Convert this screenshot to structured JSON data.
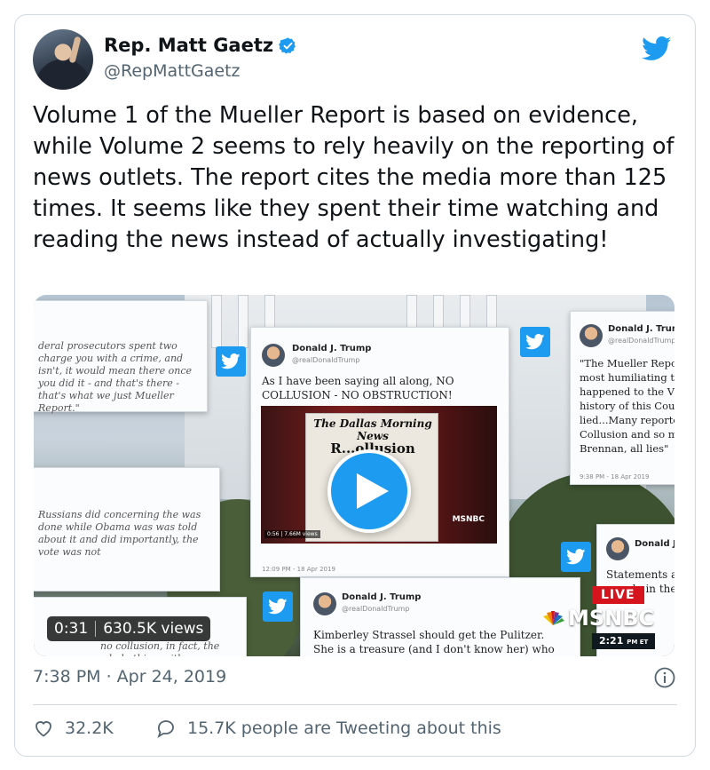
{
  "tweet": {
    "author": {
      "display_name": "Rep. Matt Gaetz",
      "handle": "@RepMattGaetz",
      "verified": true
    },
    "text": "Volume 1 of the Mueller Report is based on evidence, while Volume 2 seems to rely heavily on the reporting of news outlets. The report cites the media more than 125 times. It seems like they spent their time watching and reading the news instead of actually investigating!",
    "timestamp": "7:38 PM · Apr 24, 2019",
    "likes": "32.2K",
    "replies_label": "15.7K people are Tweeting about this"
  },
  "video": {
    "duration": "0:31",
    "views": "630.5K views",
    "overlay": {
      "live_label": "LIVE",
      "network": "MSNBC",
      "clock": "2:21",
      "clock_zone": "PM ET",
      "panel_left_top": "deral prosecutors spent two charge you with a crime, and isn't, it would mean there once you did it - and that's there - that's what we just Mueller Report.\"",
      "panel_left_mid": "Russians did concerning the was done while Obama was was told about it and did importantly, the vote was not",
      "panel_left_bottom": "no collusion, in fact, the whole thing with",
      "center_name": "Donald J. Trump",
      "center_handle": "@realDonaldTrump",
      "center_text": "As I have been saying all along, NO COLLUSION - NO OBSTRUCTION!",
      "center_time": "12:09 PM - 18 Apr 2019",
      "newspaper_title": "The Dallas Morning News",
      "newspaper_headline": "R...ollusion",
      "newspaper_views": "0:56 | 7.66M views",
      "newspaper_network": "MSNBC",
      "right_top_name": "Donald J. Trump",
      "right_top_handle": "@realDonaldTrump",
      "right_top_text": "\"The Mueller Repo most humiliating t happened to the V history of this Cou lied...Many reporte Collusion and so m Brennan, all lies\"",
      "right_top_time": "9:38 PM - 18 Apr 2019",
      "right_bottom_name": "Donald J. Tr",
      "right_bottom_text": "Statements ar people in the",
      "bottom_name": "Donald J. Trump",
      "bottom_handle": "@realDonaldTrump",
      "bottom_text": "Kimberley Strassel should get the Pulitzer. She is a treasure (and I don't know her) who"
    }
  },
  "colors": {
    "brand_blue": "#1d9bf0",
    "muted_text": "#536471",
    "live_red": "#d6141e"
  },
  "icons": {
    "logo": "twitter-bird-icon",
    "verified": "verified-badge-icon",
    "play": "play-icon",
    "info": "info-icon",
    "like": "heart-icon",
    "reply": "reply-bubble-icon"
  }
}
